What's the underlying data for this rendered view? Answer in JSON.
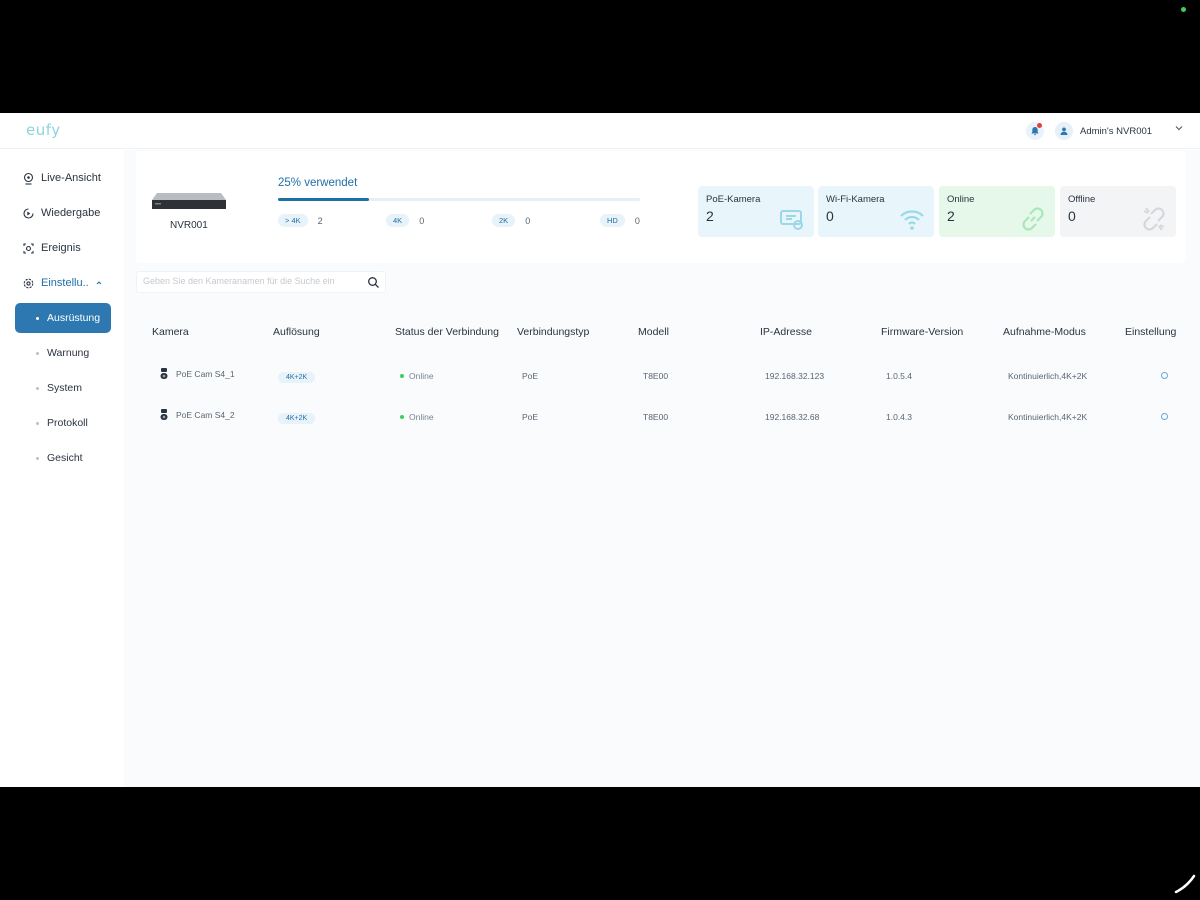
{
  "app": {
    "logo": "eufy"
  },
  "header": {
    "user_name": "Admin's NVR001"
  },
  "sidebar": {
    "items": [
      {
        "label": "Live-Ansicht"
      },
      {
        "label": "Wiedergabe"
      },
      {
        "label": "Ereignis"
      },
      {
        "label": "Einstellu.."
      }
    ],
    "sub_items": [
      {
        "label": "Ausrüstung"
      },
      {
        "label": "Warnung"
      },
      {
        "label": "System"
      },
      {
        "label": "Protokoll"
      },
      {
        "label": "Gesicht"
      }
    ]
  },
  "summary": {
    "device_name": "NVR001",
    "usage_label": "25% verwendet",
    "usage_fraction": 0.25,
    "resolutions": [
      {
        "label": "> 4K",
        "count": "2"
      },
      {
        "label": "4K",
        "count": "0"
      },
      {
        "label": "2K",
        "count": "0"
      },
      {
        "label": "HD",
        "count": "0"
      }
    ],
    "stats": [
      {
        "label": "PoE-Kamera",
        "value": "2",
        "bg": "#e8f6fb",
        "icon_color": "#7ccbe0"
      },
      {
        "label": "Wi-Fi-Kamera",
        "value": "0",
        "bg": "#e8f6fb",
        "icon_color": "#7ccbe0"
      },
      {
        "label": "Online",
        "value": "2",
        "bg": "#e6f8ea",
        "icon_color": "#8fe0a2"
      },
      {
        "label": "Offline",
        "value": "0",
        "bg": "#f3f4f5",
        "icon_color": "#c8cdd2"
      }
    ]
  },
  "search": {
    "placeholder": "Geben Sie den Kameranamen für die Suche ein"
  },
  "table": {
    "headers": [
      "Kamera",
      "Auflösung",
      "Status der Verbindung",
      "Verbindungstyp",
      "Modell",
      "IP-Adresse",
      "Firmware-Version",
      "Aufnahme-Modus",
      "Einstellung"
    ],
    "rows": [
      {
        "name": "PoE Cam S4_1",
        "resolution": "4K+2K",
        "status": "Online",
        "type": "PoE",
        "model": "T8E00",
        "ip": "192.168.32.123",
        "firmware": "1.0.5.4",
        "mode": "Kontinuierlich,4K+2K"
      },
      {
        "name": "PoE Cam S4_2",
        "resolution": "4K+2K",
        "status": "Online",
        "type": "PoE",
        "model": "T8E00",
        "ip": "192.168.32.68",
        "firmware": "1.0.4.3",
        "mode": "Kontinuierlich,4K+2K"
      }
    ]
  },
  "colors": {
    "accent": "#1f6fa8",
    "online": "#3ccf5a"
  }
}
